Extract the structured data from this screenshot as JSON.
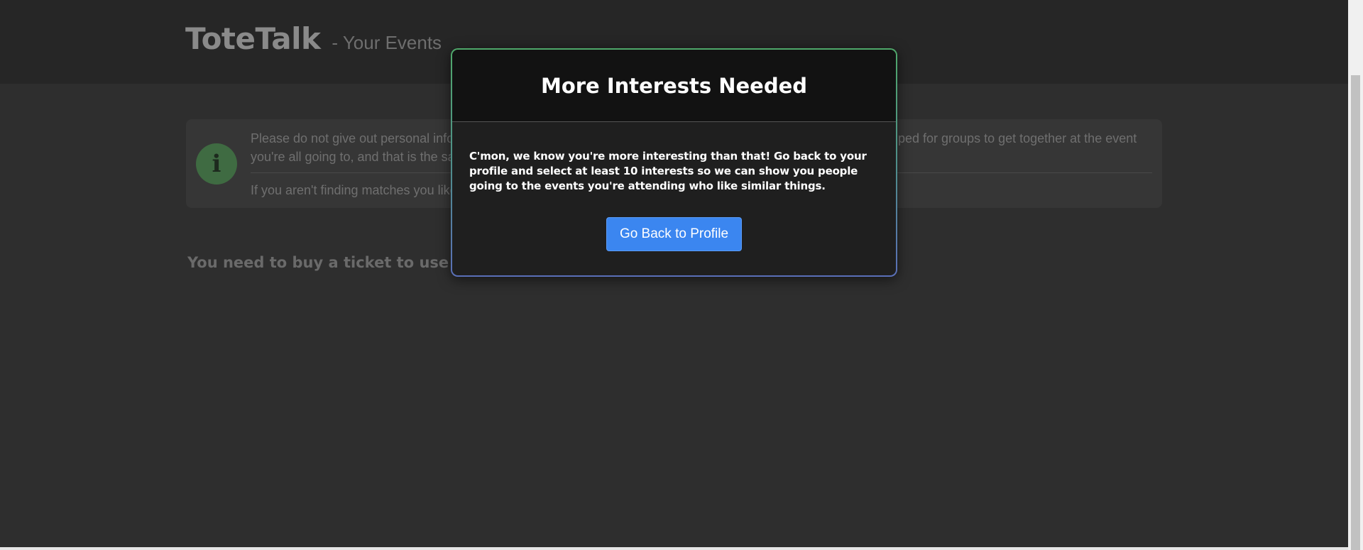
{
  "header": {
    "brand": "ToteTalk",
    "subtitle": "- Your Events"
  },
  "info_panel": {
    "icon": "info-icon",
    "line1": "Please do not give out personal infor",
    "line1_end": "ped for groups to get together at the event",
    "line2": "you're all going to, and that is the sa",
    "line3": "If you aren't finding matches you like"
  },
  "main": {
    "ticket_notice": "You need to buy a ticket to use this"
  },
  "modal": {
    "title": "More Interests Needed",
    "body": "C'mon, we know you're more interesting than that! Go back to your profile and select at least 10 interests so we can show you people going to the events you're attending who like similar things.",
    "button_label": "Go Back to Profile",
    "button_color": "#3b86f0"
  }
}
